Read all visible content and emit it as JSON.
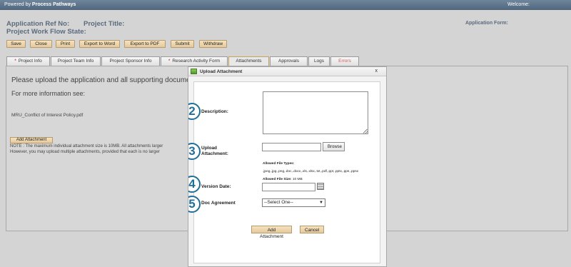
{
  "topbar": {
    "powered_prefix": "Powered by ",
    "powered_brand": "Process Pathways",
    "welcome": "Welcome:"
  },
  "header": {
    "app_ref": "Application Ref No:",
    "project_title": "Project Title:",
    "workflow_state": "Project Work Flow State:",
    "app_form": "Application Form:"
  },
  "toolbar": [
    "Save",
    "Close",
    "Print",
    "Export to Word",
    "Export to PDF",
    "Submit",
    "Withdraw"
  ],
  "tabs": [
    {
      "label": "Project Info",
      "required": true
    },
    {
      "label": "Project Team Info",
      "required": false
    },
    {
      "label": "Project Sponsor Info",
      "required": false
    },
    {
      "label": "Research Activity Form",
      "required": true
    },
    {
      "label": "Attachments",
      "required": false,
      "active": true
    },
    {
      "label": "Approvals",
      "required": false
    },
    {
      "label": "Logs",
      "required": false
    },
    {
      "label": "Errors",
      "required": false,
      "color": "#d05a5a"
    }
  ],
  "panel": {
    "intro": "Please upload the application and all supporting documentation",
    "more_info": "For more information see:",
    "file_link": "MRU_Conflict of Interest Policy.pdf",
    "add_attachment": "Add Attachment",
    "note1": "NOTE : The maximum individual attachment size is 10MB. All attachments larger",
    "note2": "However, you may upload multiple attachments, provided that each is no larger"
  },
  "dialog": {
    "title": "Upload Attachment",
    "close": "x",
    "step_numbers": [
      "2",
      "3",
      "4",
      "5"
    ],
    "description_label": "Description:",
    "upload_label_1": "Upload",
    "upload_label_2": "Attachment:",
    "browse": "Browse",
    "allowed_types_label": "Allowed File Types:",
    "allowed_types": ".jpeg,.jpg,.png,.doc,.docx,.xls,.xlsx,.txt,.pdf,.ppt,.pptx,.pps,.ppsx",
    "allowed_size_label": "Allowed File Size:",
    "allowed_size": "10 MB",
    "version_date_label": "Version Date:",
    "doc_agreement_label": "Doc Agreement",
    "doc_agreement_value": "--Select One--",
    "add_button": "Add Attachment",
    "cancel_button": "Cancel",
    "accent_color": "#1f6f98"
  }
}
